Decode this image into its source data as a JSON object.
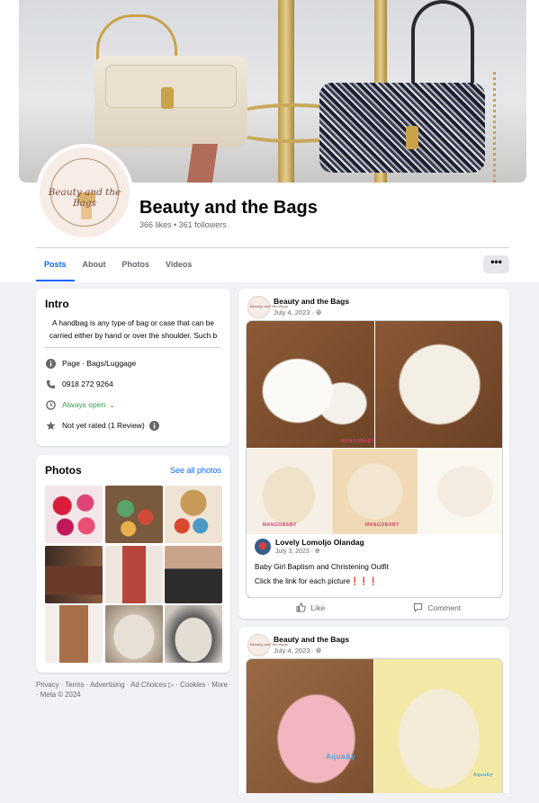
{
  "page": {
    "name": "Beauty and the Bags",
    "stats": "366 likes • 361 followers",
    "logo_text": "Beauty and the Bags"
  },
  "tabs": [
    "Posts",
    "About",
    "Photos",
    "Videos"
  ],
  "more_button": "•••",
  "intro": {
    "title": "Intro",
    "bio_line1": "A handbag is any type of bag or case that can be",
    "bio_line2": "carried either by hand or over the shoulder. Such b",
    "category": "Page · Bags/Luggage",
    "phone": "0918 272 9264",
    "hours": "Always open",
    "rating": "Not yet rated (1 Review)"
  },
  "photos": {
    "title": "Photos",
    "see_all": "See all photos"
  },
  "footer": {
    "line1": "Privacy · Terms · Advertising · Ad Choices ▷ · Cookies · More",
    "line2": "· Meta © 2024"
  },
  "posts": [
    {
      "author": "Beauty and the Bags",
      "date": "July 4, 2023 · ",
      "shared_author": "Lovely Lomoljo Olandag",
      "shared_date": "July 3, 2023 · ",
      "shared_text1": "Baby Girl Baptism and Christening Outfit",
      "shared_text2": "Click the link for each picture❗❗❗",
      "image_tag1": "MANGOBABY",
      "image_tag2": "MANGOBABY",
      "image_tag3": "MANGOBABY",
      "like": "Like",
      "comment": "Comment"
    },
    {
      "author": "Beauty and the Bags",
      "date": "July 4, 2023 · ",
      "image_tag1": "Aqua&y",
      "image_tag2": "Aqua&y"
    }
  ],
  "colors": {
    "accent": "#0866ff",
    "green": "#31a24c",
    "background": "#f0f2f5"
  }
}
